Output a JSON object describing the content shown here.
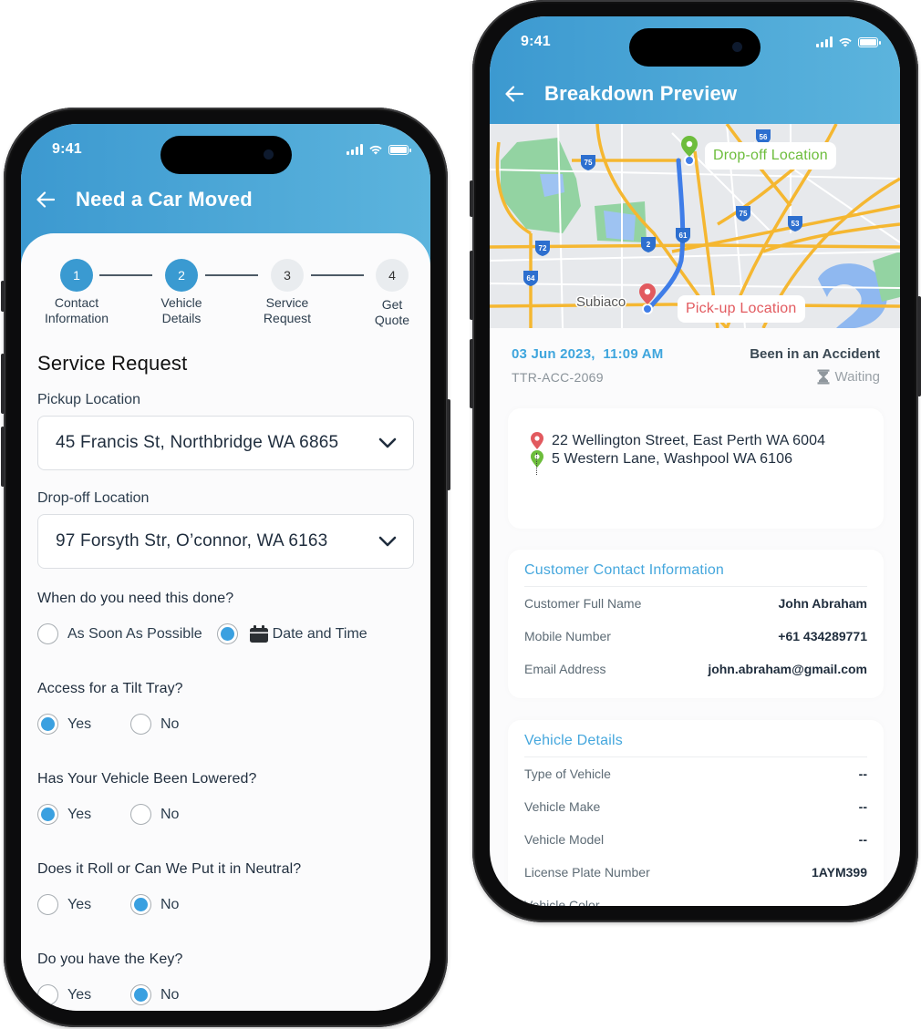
{
  "left_phone": {
    "status_bar": {
      "time": "9:41"
    },
    "header": {
      "title": "Need a Car Moved",
      "back_icon": "arrow-left-icon"
    },
    "stepper": {
      "steps": [
        {
          "number": "1",
          "label_line1": "Contact",
          "label_line2": "Information",
          "state": "done"
        },
        {
          "number": "2",
          "label_line1": "Vehicle",
          "label_line2": "Details",
          "state": "done"
        },
        {
          "number": "3",
          "label_line1": "Service",
          "label_line2": "Request",
          "state": "todo"
        },
        {
          "number": "4",
          "label_line1": "Get",
          "label_line2": "Quote",
          "state": "todo"
        }
      ]
    },
    "form": {
      "section_title": "Service Request",
      "pickup": {
        "label": "Pickup Location",
        "value": "45 Francis St, Northbridge WA 6865"
      },
      "dropoff": {
        "label": "Drop-off Location",
        "value": "97 Forsyth Str, O’connor, WA 6163"
      },
      "when": {
        "question": "When do you need this done?",
        "options": [
          {
            "label": "As Soon As Possible",
            "selected": false
          },
          {
            "label": "Date and Time",
            "selected": true,
            "icon": "calendar-icon"
          }
        ]
      },
      "questions": [
        {
          "question": "Access for a Tilt Tray?",
          "yes_label": "Yes",
          "no_label": "No",
          "answer": "yes"
        },
        {
          "question": "Has Your Vehicle Been Lowered?",
          "yes_label": "Yes",
          "no_label": "No",
          "answer": "yes"
        },
        {
          "question": "Does it Roll or Can We Put it in Neutral?",
          "yes_label": "Yes",
          "no_label": "No",
          "answer": "no"
        },
        {
          "question": "Do you have the Key?",
          "yes_label": "Yes",
          "no_label": "No",
          "answer": "no"
        }
      ]
    }
  },
  "right_phone": {
    "status_bar": {
      "time": "9:41"
    },
    "header": {
      "title": "Breakdown Preview",
      "back_icon": "arrow-left-icon"
    },
    "map": {
      "dropoff_tag": "Drop-off Location",
      "pickup_tag": "Pick-up Location",
      "place_label": "Subiaco",
      "route_shields": [
        "56",
        "75",
        "75",
        "53",
        "72",
        "2",
        "61",
        "64"
      ]
    },
    "booking": {
      "datetime": "03 Jun 2023,  11:09 AM",
      "incident_type": "Been in an Accident",
      "reference": "TTR-ACC-2069",
      "status": "Waiting",
      "status_icon": "hourglass-icon"
    },
    "route": {
      "from": "22 Wellington Street, East Perth WA 6004",
      "to": "5 Western Lane, Washpool WA 6106"
    },
    "customer_contact": {
      "title": "Customer Contact Information",
      "rows": [
        {
          "label": "Customer Full Name",
          "value": "John Abraham"
        },
        {
          "label": "Mobile Number",
          "value": "+61 434289771"
        },
        {
          "label": "Email Address",
          "value": "john.abraham@gmail.com"
        }
      ]
    },
    "vehicle_details": {
      "title": "Vehicle Details",
      "rows": [
        {
          "label": "Type of Vehicle",
          "value": "--"
        },
        {
          "label": "Vehicle Make",
          "value": "--"
        },
        {
          "label": "Vehicle Model",
          "value": "--"
        },
        {
          "label": "License Plate Number",
          "value": "1AYM399"
        },
        {
          "label": "Vehicle Color",
          "value": "--"
        }
      ]
    }
  },
  "colors": {
    "header_start": "#3c99d0",
    "header_end": "#5cb4dd",
    "accent_blue": "#3aa0e0",
    "dropoff_green": "#6dbd3c",
    "pickup_red": "#e25a5f"
  }
}
